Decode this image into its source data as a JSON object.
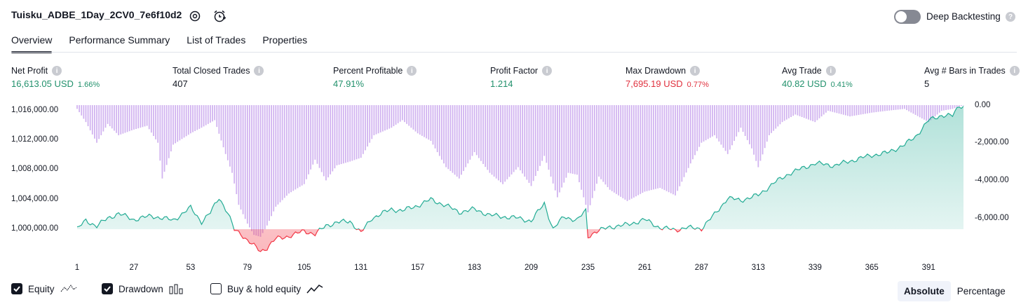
{
  "header": {
    "title": "Tuisku_ADBE_1Day_2CV0_7e6f10d2",
    "settings_icon": "gear-icon",
    "alert_icon": "alarm-clock-icon",
    "deep_backtesting_label": "Deep Backtesting",
    "deep_backtesting_enabled": false
  },
  "tabs": [
    {
      "label": "Overview",
      "active": true
    },
    {
      "label": "Performance Summary",
      "active": false
    },
    {
      "label": "List of Trades",
      "active": false
    },
    {
      "label": "Properties",
      "active": false
    }
  ],
  "metrics": {
    "net_profit": {
      "label": "Net Profit",
      "value": "16,613.05 USD",
      "percent": "1.66%"
    },
    "total_closed_trades": {
      "label": "Total Closed Trades",
      "value": "407"
    },
    "percent_profitable": {
      "label": "Percent Profitable",
      "value": "47.91%"
    },
    "profit_factor": {
      "label": "Profit Factor",
      "value": "1.214"
    },
    "max_drawdown": {
      "label": "Max Drawdown",
      "value": "7,695.19 USD",
      "percent": "0.77%"
    },
    "avg_trade": {
      "label": "Avg Trade",
      "value": "40.82 USD",
      "percent": "0.41%"
    },
    "avg_bars": {
      "label": "Avg # Bars in Trades",
      "value": "5"
    }
  },
  "chart_data": {
    "type": "line",
    "x_ticks": [
      "1",
      "27",
      "53",
      "79",
      "105",
      "131",
      "157",
      "183",
      "209",
      "235",
      "261",
      "287",
      "313",
      "339",
      "365",
      "391"
    ],
    "y_left_ticks": [
      "1,016,000.00",
      "1,012,000.00",
      "1,008,000.00",
      "1,004,000.00",
      "1,000,000.00"
    ],
    "y_right_ticks": [
      "0.00",
      "-2,000.00",
      "-4,000.00",
      "-6,000.00"
    ],
    "xlim": [
      1,
      407
    ],
    "ylim_left": [
      999000,
      1017000
    ],
    "ylim_right": [
      -7000,
      0
    ],
    "equity_color": "#22ab94",
    "equity_negative_color": "#f23645",
    "drawdown_color": "#d1b3f0",
    "equity": [
      [
        1,
        1000000
      ],
      [
        5,
        1001200
      ],
      [
        10,
        1000400
      ],
      [
        15,
        1001500
      ],
      [
        20,
        1002100
      ],
      [
        27,
        1001300
      ],
      [
        35,
        1001800
      ],
      [
        45,
        1001200
      ],
      [
        53,
        1002900
      ],
      [
        58,
        1001000
      ],
      [
        62,
        1002200
      ],
      [
        66,
        1004300
      ],
      [
        70,
        1002200
      ],
      [
        73,
        999900
      ],
      [
        76,
        999400
      ],
      [
        79,
        998500
      ],
      [
        83,
        997500
      ],
      [
        85,
        997000
      ],
      [
        88,
        997500
      ],
      [
        92,
        998700
      ],
      [
        100,
        999200
      ],
      [
        105,
        999800
      ],
      [
        110,
        999300
      ],
      [
        115,
        1000500
      ],
      [
        120,
        1000900
      ],
      [
        126,
        1001100
      ],
      [
        131,
        999500
      ],
      [
        136,
        1001500
      ],
      [
        145,
        1002700
      ],
      [
        150,
        1002500
      ],
      [
        157,
        1003200
      ],
      [
        163,
        1004000
      ],
      [
        170,
        1003200
      ],
      [
        176,
        1002300
      ],
      [
        183,
        1002700
      ],
      [
        190,
        1001900
      ],
      [
        196,
        1001700
      ],
      [
        203,
        1001500
      ],
      [
        209,
        1001100
      ],
      [
        215,
        1003500
      ],
      [
        219,
        1000000
      ],
      [
        224,
        1001700
      ],
      [
        230,
        1001200
      ],
      [
        234,
        1002500
      ],
      [
        235,
        999000
      ],
      [
        238,
        999600
      ],
      [
        245,
        1000300
      ],
      [
        253,
        1000600
      ],
      [
        261,
        1001300
      ],
      [
        268,
        1000200
      ],
      [
        275,
        999900
      ],
      [
        280,
        1000200
      ],
      [
        287,
        1000100
      ],
      [
        293,
        1002000
      ],
      [
        299,
        1004200
      ],
      [
        305,
        1003900
      ],
      [
        313,
        1004600
      ],
      [
        320,
        1006200
      ],
      [
        327,
        1007500
      ],
      [
        333,
        1008200
      ],
      [
        339,
        1008900
      ],
      [
        348,
        1008600
      ],
      [
        355,
        1009200
      ],
      [
        365,
        1010000
      ],
      [
        372,
        1010300
      ],
      [
        380,
        1011400
      ],
      [
        385,
        1012500
      ],
      [
        391,
        1014700
      ],
      [
        397,
        1015400
      ],
      [
        402,
        1015300
      ],
      [
        405,
        1016700
      ],
      [
        407,
        1016600
      ]
    ],
    "drawdown": [
      [
        1,
        -200
      ],
      [
        5,
        -900
      ],
      [
        10,
        -2000
      ],
      [
        15,
        -1000
      ],
      [
        20,
        -1600
      ],
      [
        27,
        -1300
      ],
      [
        33,
        -1100
      ],
      [
        38,
        -2000
      ],
      [
        40,
        -3900
      ],
      [
        45,
        -2100
      ],
      [
        53,
        -1500
      ],
      [
        58,
        -1200
      ],
      [
        64,
        -800
      ],
      [
        69,
        -2600
      ],
      [
        72,
        -3600
      ],
      [
        75,
        -5300
      ],
      [
        79,
        -6300
      ],
      [
        82,
        -6900
      ],
      [
        85,
        -7000
      ],
      [
        88,
        -6400
      ],
      [
        92,
        -5400
      ],
      [
        98,
        -4700
      ],
      [
        105,
        -4200
      ],
      [
        110,
        -2900
      ],
      [
        115,
        -4000
      ],
      [
        120,
        -3200
      ],
      [
        126,
        -3000
      ],
      [
        131,
        -2800
      ],
      [
        137,
        -1600
      ],
      [
        145,
        -1200
      ],
      [
        150,
        -800
      ],
      [
        157,
        -1500
      ],
      [
        163,
        -1900
      ],
      [
        170,
        -3300
      ],
      [
        176,
        -3900
      ],
      [
        183,
        -2500
      ],
      [
        190,
        -3600
      ],
      [
        196,
        -4200
      ],
      [
        203,
        -3300
      ],
      [
        209,
        -4300
      ],
      [
        215,
        -2700
      ],
      [
        221,
        -4900
      ],
      [
        226,
        -3600
      ],
      [
        230,
        -3700
      ],
      [
        235,
        -5700
      ],
      [
        240,
        -3800
      ],
      [
        245,
        -4500
      ],
      [
        253,
        -5100
      ],
      [
        261,
        -4600
      ],
      [
        268,
        -4400
      ],
      [
        275,
        -4800
      ],
      [
        282,
        -3100
      ],
      [
        287,
        -2000
      ],
      [
        293,
        -1600
      ],
      [
        299,
        -2600
      ],
      [
        305,
        -1200
      ],
      [
        310,
        -2300
      ],
      [
        313,
        -3300
      ],
      [
        318,
        -1600
      ],
      [
        324,
        -900
      ],
      [
        330,
        -500
      ],
      [
        339,
        -900
      ],
      [
        345,
        -300
      ],
      [
        355,
        -600
      ],
      [
        365,
        -400
      ],
      [
        372,
        -300
      ],
      [
        380,
        -200
      ],
      [
        391,
        -900
      ],
      [
        397,
        -300
      ],
      [
        402,
        -200
      ],
      [
        407,
        0
      ]
    ]
  },
  "legend": {
    "equity": {
      "label": "Equity",
      "checked": true,
      "icon": "equity-line-icon"
    },
    "drawdown": {
      "label": "Drawdown",
      "checked": true,
      "icon": "drawdown-bars-icon"
    },
    "buy_hold": {
      "label": "Buy & hold equity",
      "checked": false,
      "icon": "buy-hold-line-icon"
    }
  },
  "view_mode": {
    "options": [
      "Absolute",
      "Percentage"
    ],
    "selected": "Absolute"
  }
}
